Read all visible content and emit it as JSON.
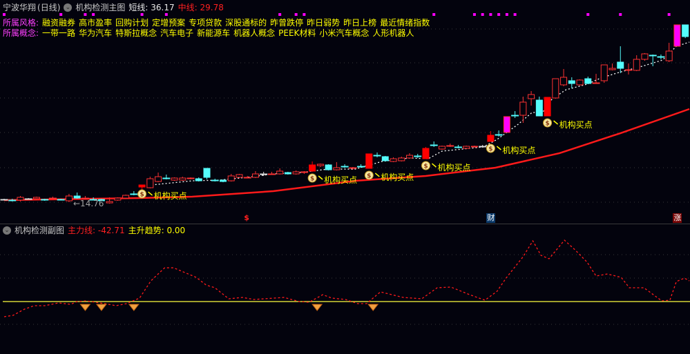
{
  "header": {
    "stock_name": "宁波华翔",
    "period": "(日线)",
    "indicator_name": "机构检测主图",
    "short_line_label": "短线:",
    "short_line_value": "36.17",
    "mid_line_label": "中线:",
    "mid_line_value": "29.78"
  },
  "style_row": {
    "label": "所属风格:",
    "tags": [
      "融资融券",
      "高市盈率",
      "回购计划",
      "定增预案",
      "专项贷款",
      "深股通标的",
      "昨曾跌停",
      "昨日弱势",
      "昨日上榜",
      "最近情绪指数"
    ]
  },
  "concept_row": {
    "label": "所属概念:",
    "tags": [
      "一带一路",
      "华为汽车",
      "特斯拉概念",
      "汽车电子",
      "新能源车",
      "机器人概念",
      "PEEK材料",
      "小米汽车概念",
      "人形机器人"
    ]
  },
  "main_chart": {
    "low_label": "←14.76",
    "signal_label": "机构买点",
    "signal_candles": [
      17,
      38,
      45,
      52,
      60,
      67
    ],
    "top_dot_candles": [
      0,
      7,
      10,
      11,
      17,
      20,
      34,
      36,
      37,
      53,
      58,
      59,
      60,
      61,
      62,
      63,
      72,
      76,
      82
    ],
    "markers": [
      {
        "text": "$",
        "candle": 30,
        "kind": "dollar"
      },
      {
        "text": "财",
        "candle": 60,
        "kind": "finance"
      },
      {
        "text": "涨",
        "candle": 83,
        "kind": "rise"
      }
    ],
    "candles_ochl_kind": [
      [
        15.31,
        15.31,
        15.4,
        15.22,
        "w"
      ],
      [
        15.22,
        15.22,
        15.4,
        15.04,
        "c"
      ],
      [
        15.22,
        15.59,
        15.77,
        15.04,
        "u"
      ],
      [
        15.4,
        15.4,
        15.49,
        15.31,
        "w"
      ],
      [
        15.4,
        15.59,
        15.68,
        15.31,
        "u"
      ],
      [
        15.31,
        15.31,
        15.4,
        15.13,
        "c"
      ],
      [
        15.49,
        15.49,
        15.68,
        15.4,
        "r"
      ],
      [
        15.31,
        15.31,
        15.4,
        15.22,
        "c"
      ],
      [
        15.13,
        15.77,
        16.05,
        14.95,
        "u"
      ],
      [
        15.77,
        15.49,
        16.23,
        15.4,
        "d"
      ],
      [
        15.49,
        15.49,
        15.77,
        15.31,
        "r"
      ],
      [
        15.31,
        15.31,
        15.59,
        15.22,
        "c"
      ],
      [
        15.31,
        15.13,
        15.4,
        15.04,
        "d"
      ],
      [
        14.85,
        15.04,
        15.59,
        14.76,
        "u"
      ],
      [
        15.22,
        15.49,
        15.59,
        15.13,
        "u"
      ],
      [
        15.49,
        15.86,
        15.95,
        15.4,
        "u"
      ],
      [
        16.05,
        16.05,
        16.42,
        15.86,
        "c"
      ],
      [
        16.96,
        17.24,
        17.24,
        16.14,
        "s"
      ],
      [
        16.87,
        18.07,
        18.34,
        16.78,
        "u"
      ],
      [
        17.7,
        18.34,
        18.89,
        17.6,
        "u"
      ],
      [
        18.16,
        18.16,
        18.62,
        17.98,
        "c"
      ],
      [
        17.88,
        18.16,
        18.25,
        17.79,
        "u"
      ],
      [
        17.88,
        18.16,
        18.34,
        17.79,
        "u"
      ],
      [
        18.16,
        18.16,
        18.25,
        17.98,
        "r"
      ],
      [
        18.07,
        17.79,
        18.25,
        17.7,
        "d"
      ],
      [
        19.45,
        18.25,
        19.45,
        17.98,
        "d"
      ],
      [
        17.88,
        17.88,
        18.07,
        17.7,
        "c"
      ],
      [
        17.88,
        17.7,
        17.98,
        17.6,
        "d"
      ],
      [
        17.79,
        18.44,
        18.71,
        17.7,
        "u"
      ],
      [
        18.25,
        18.62,
        18.71,
        18.16,
        "u"
      ],
      [
        18.25,
        18.25,
        18.44,
        18.16,
        "r"
      ],
      [
        18.25,
        18.71,
        19.08,
        18.16,
        "u"
      ],
      [
        18.71,
        18.71,
        18.99,
        18.44,
        "w"
      ],
      [
        18.71,
        18.71,
        18.99,
        18.62,
        "r"
      ],
      [
        18.71,
        19.08,
        19.45,
        18.62,
        "u"
      ],
      [
        18.89,
        18.71,
        18.99,
        18.62,
        "d"
      ],
      [
        18.71,
        18.99,
        19.17,
        18.62,
        "u"
      ],
      [
        18.99,
        18.99,
        19.08,
        18.71,
        "r"
      ],
      [
        19.08,
        19.91,
        20.37,
        18.99,
        "s"
      ],
      [
        19.81,
        20.0,
        20.09,
        19.63,
        "u"
      ],
      [
        19.91,
        19.26,
        20.0,
        19.17,
        "d"
      ],
      [
        19.26,
        19.54,
        20.28,
        19.17,
        "u"
      ],
      [
        19.72,
        19.72,
        20.0,
        19.54,
        "c"
      ],
      [
        19.54,
        19.54,
        19.63,
        19.26,
        "r"
      ],
      [
        19.72,
        19.72,
        20.0,
        19.54,
        "c"
      ],
      [
        19.45,
        21.38,
        21.38,
        19.45,
        "s"
      ],
      [
        21.19,
        21.19,
        21.56,
        20.92,
        "c"
      ],
      [
        21.01,
        20.46,
        21.1,
        20.37,
        "d"
      ],
      [
        20.37,
        20.73,
        20.92,
        20.28,
        "u"
      ],
      [
        20.46,
        20.83,
        21.01,
        20.37,
        "u"
      ],
      [
        20.83,
        21.19,
        21.47,
        20.73,
        "u"
      ],
      [
        21.1,
        21.1,
        21.38,
        20.83,
        "c"
      ],
      [
        20.73,
        22.11,
        22.3,
        20.73,
        "s"
      ],
      [
        22.57,
        22.57,
        23.03,
        22.3,
        "c"
      ],
      [
        22.02,
        22.39,
        22.48,
        21.93,
        "u"
      ],
      [
        22.48,
        22.48,
        22.75,
        22.3,
        "r"
      ],
      [
        22.3,
        22.3,
        22.57,
        22.11,
        "c"
      ],
      [
        22.11,
        22.39,
        22.48,
        22.02,
        "u"
      ],
      [
        22.3,
        22.39,
        22.48,
        22.21,
        "u"
      ],
      [
        22.39,
        22.39,
        22.57,
        22.21,
        "w"
      ],
      [
        23.03,
        23.86,
        24.41,
        23.03,
        "s"
      ],
      [
        23.95,
        23.95,
        24.5,
        23.68,
        "c"
      ],
      [
        24.23,
        26.34,
        26.34,
        24.23,
        "m"
      ],
      [
        26.52,
        26.52,
        27.07,
        26.16,
        "c"
      ],
      [
        26.52,
        28.27,
        29.0,
        25.51,
        "u"
      ],
      [
        28.73,
        29.28,
        29.74,
        27.81,
        "u"
      ],
      [
        28.54,
        26.43,
        29.0,
        26.43,
        "d"
      ],
      [
        26.43,
        28.91,
        28.91,
        26.43,
        "s"
      ],
      [
        28.82,
        31.39,
        31.39,
        28.73,
        "u"
      ],
      [
        30.57,
        31.58,
        32.68,
        30.38,
        "u"
      ],
      [
        31.12,
        30.75,
        31.58,
        30.11,
        "d"
      ],
      [
        30.57,
        31.21,
        31.3,
        30.48,
        "u"
      ],
      [
        31.39,
        30.75,
        31.67,
        30.66,
        "d"
      ],
      [
        30.84,
        30.84,
        32.04,
        30.75,
        "r"
      ],
      [
        31.12,
        33.23,
        33.23,
        30.84,
        "u"
      ],
      [
        32.59,
        32.77,
        33.42,
        32.5,
        "u"
      ],
      [
        33.6,
        32.77,
        35.71,
        32.13,
        "d"
      ],
      [
        32.59,
        32.59,
        33.42,
        31.95,
        "r"
      ],
      [
        32.5,
        33.97,
        34.52,
        32.4,
        "u"
      ],
      [
        33.97,
        34.7,
        34.8,
        33.78,
        "u"
      ],
      [
        34.52,
        34.52,
        34.61,
        33.05,
        "c"
      ],
      [
        34.33,
        34.33,
        34.61,
        33.97,
        "c"
      ],
      [
        33.78,
        35.07,
        36.17,
        33.6,
        "u"
      ],
      [
        35.71,
        38.56,
        38.56,
        35.71,
        "m"
      ],
      [
        38.56,
        37.0,
        38.56,
        36.8,
        "d"
      ]
    ],
    "short_line_knots": [
      [
        18.2,
        17.24
      ],
      [
        23.2,
        17.79
      ],
      [
        26.5,
        17.88
      ],
      [
        29.9,
        18.25
      ],
      [
        33.2,
        18.71
      ],
      [
        36.6,
        18.89
      ],
      [
        39.9,
        19.35
      ],
      [
        43.3,
        19.35
      ],
      [
        46.6,
        20.37
      ],
      [
        50,
        20.83
      ],
      [
        52.3,
        20.73
      ],
      [
        54,
        21.74
      ],
      [
        59.1,
        22.3
      ],
      [
        60.8,
        23.31
      ],
      [
        63.4,
        25.33
      ],
      [
        65.1,
        26.89
      ],
      [
        66.4,
        26.89
      ],
      [
        67.6,
        28.73
      ],
      [
        69.3,
        29.92
      ],
      [
        71.9,
        30.66
      ],
      [
        73.6,
        31.49
      ],
      [
        76.1,
        32.31
      ],
      [
        78.7,
        33.05
      ],
      [
        81.2,
        33.87
      ],
      [
        82.9,
        35.71
      ],
      [
        84.5,
        36.26
      ]
    ],
    "mid_line_knots": [
      [
        0,
        15.22
      ],
      [
        16.6,
        15.49
      ],
      [
        23.2,
        15.68
      ],
      [
        33.2,
        16.41
      ],
      [
        43.3,
        17.79
      ],
      [
        52,
        18.44
      ],
      [
        60.6,
        19.54
      ],
      [
        68.5,
        21.47
      ],
      [
        76,
        24.13
      ],
      [
        84.5,
        27.35
      ]
    ],
    "colors": {
      "up": "#ff3232",
      "down": "#54fcfc",
      "signal": "#ff0000",
      "magenta": "#ff00ff",
      "mid_line": "#ff1a1a",
      "short_line": "#ffffff"
    }
  },
  "sub_chart": {
    "indicator_name": "机构检测副图",
    "main_force_label": "主力线:",
    "main_force_value": "-42.71",
    "trend_label": "主升趋势:",
    "trend_value": "0.00",
    "diamond_candles": [
      10,
      12,
      16,
      38.6,
      45.5
    ],
    "main_force_knots": [
      [
        0,
        -32.3
      ],
      [
        1.1,
        -29.4
      ],
      [
        2.5,
        -16.2
      ],
      [
        3.7,
        -8.8
      ],
      [
        5,
        -8.8
      ],
      [
        6.7,
        -2.9
      ],
      [
        8.2,
        -5.9
      ],
      [
        9,
        0
      ],
      [
        10.1,
        1.5
      ],
      [
        12.4,
        -4.4
      ],
      [
        13.8,
        -8.8
      ],
      [
        15.1,
        -4.4
      ],
      [
        16.7,
        7.4
      ],
      [
        18.1,
        44.1
      ],
      [
        19.8,
        72
      ],
      [
        20.9,
        72
      ],
      [
        22.3,
        61.7
      ],
      [
        23.7,
        51.5
      ],
      [
        24.9,
        35.3
      ],
      [
        26,
        29.4
      ],
      [
        27.7,
        5.9
      ],
      [
        29.4,
        8.8
      ],
      [
        30.8,
        4.4
      ],
      [
        34.5,
        8.8
      ],
      [
        36.4,
        0
      ],
      [
        37.6,
        -1.5
      ],
      [
        39.3,
        14.7
      ],
      [
        40.4,
        7.4
      ],
      [
        42.1,
        4.4
      ],
      [
        43.6,
        -4.4
      ],
      [
        44.7,
        -4.4
      ],
      [
        46.4,
        20.6
      ],
      [
        49.2,
        8.8
      ],
      [
        51.5,
        5.9
      ],
      [
        53.4,
        29.4
      ],
      [
        55.1,
        30.9
      ],
      [
        57.4,
        14.7
      ],
      [
        59.3,
        2.9
      ],
      [
        60.8,
        22.1
      ],
      [
        61.9,
        50
      ],
      [
        64,
        95.6
      ],
      [
        65.2,
        129.4
      ],
      [
        66.2,
        98.5
      ],
      [
        67.2,
        91.2
      ],
      [
        69.1,
        130.8
      ],
      [
        70.4,
        110.3
      ],
      [
        71.9,
        83.8
      ],
      [
        73,
        54.4
      ],
      [
        74.4,
        58.8
      ],
      [
        76.1,
        51.5
      ],
      [
        77.1,
        29.4
      ],
      [
        78.9,
        29.4
      ],
      [
        81.1,
        1.5
      ],
      [
        82.1,
        2.9
      ],
      [
        82.9,
        42.6
      ],
      [
        83.9,
        50
      ],
      [
        84.5,
        44.1
      ]
    ],
    "colors": {
      "main_force": "#ff1a1a",
      "zero_line": "#ffff40"
    }
  }
}
